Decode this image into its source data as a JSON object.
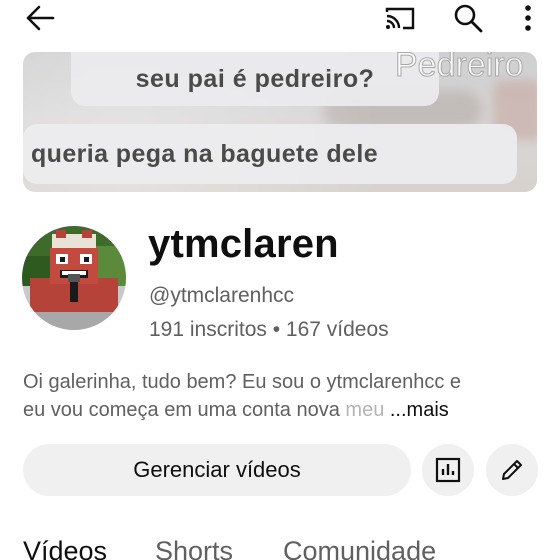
{
  "topbar": {
    "back_icon": "arrow-left-icon",
    "cast_icon": "cast-icon",
    "search_icon": "search-icon",
    "more_icon": "more-vertical-icon"
  },
  "banner": {
    "caption_top": "seu pai é pedreiro?",
    "caption_bottom": "queria pega na baguete dele",
    "watermark": "Pedreiro"
  },
  "channel": {
    "name": "ytmclaren",
    "handle": "@ytmclarenhcc",
    "stats": "191 inscritos • 167 vídeos",
    "description_line1": "Oi galerinha, tudo bem? Eu sou o ytmclarenhcc e",
    "description_line2": "eu vou começa em uma conta nova ",
    "description_faded": "meu",
    "description_more": "...mais"
  },
  "actions": {
    "manage_label": "Gerenciar vídeos",
    "analytics_icon": "analytics-icon",
    "edit_icon": "pencil-icon"
  },
  "tabs": [
    {
      "label": "Vídeos"
    },
    {
      "label": "Shorts"
    },
    {
      "label": "Comunidade"
    }
  ]
}
